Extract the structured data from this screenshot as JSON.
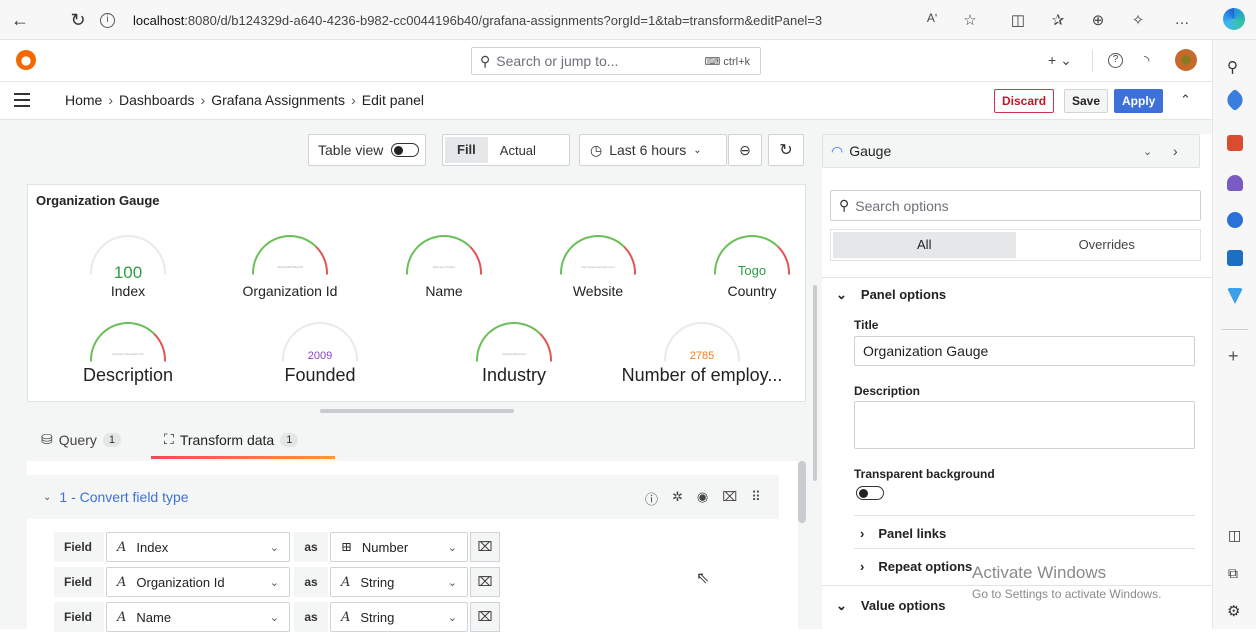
{
  "browser": {
    "url_host": "localhost",
    "url_rest": ":8080/d/b124329d-a640-4236-b982-cc0044196b40/grafana-assignments?orgId=1&tab=transform&editPanel=3",
    "read_aloud": "Aʹ",
    "more": "…"
  },
  "topbar": {
    "search_placeholder": "Search or jump to...",
    "search_shortcut": "ctrl+k",
    "plus": "+ ⌄"
  },
  "breadcrumb": {
    "items": [
      "Home",
      "Dashboards",
      "Grafana Assignments",
      "Edit panel"
    ],
    "separator": "›",
    "discard": "Discard",
    "save": "Save",
    "apply": "Apply"
  },
  "toolbar": {
    "table_view": "Table view",
    "fill": "Fill",
    "actual": "Actual",
    "time_range": "Last 6 hours"
  },
  "panel": {
    "title": "Organization Gauge",
    "gauges": [
      {
        "label": "Index",
        "value": "100",
        "value_color": "#2f9e44",
        "arc_color": "#e8eaed",
        "tiny": ""
      },
      {
        "label": "Organization Id",
        "value": "",
        "value_color": "#999",
        "arc_color": "#6bbf59",
        "tiny": "a1b2c3d4e5f6g7h8"
      },
      {
        "label": "Name",
        "value": "",
        "value_color": "#999",
        "arc_color": "#6bbf59",
        "tiny": "Robinson Parker"
      },
      {
        "label": "Website",
        "value": "",
        "value_color": "#999",
        "arc_color": "#6bbf59",
        "tiny": "http://www.example.com/"
      },
      {
        "label": "Country",
        "value": "Togo",
        "value_color": "#2f9e44",
        "arc_color": "#6bbf59",
        "tiny": ""
      },
      {
        "label": "Description",
        "value": "",
        "value_color": "#999",
        "arc_color": "#6bbf59",
        "tiny": "Focused bifurcated info"
      },
      {
        "label": "Founded",
        "value": "2009",
        "value_color": "#8a44c8",
        "arc_color": "#e8eaed",
        "tiny": ""
      },
      {
        "label": "Industry",
        "value": "",
        "value_color": "#999",
        "arc_color": "#6bbf59",
        "tiny": "Plastics Business"
      },
      {
        "label": "Number of employ...",
        "value": "2785",
        "value_color": "#f57c20",
        "arc_color": "#e8eaed",
        "tiny": ""
      }
    ]
  },
  "tabs": [
    {
      "label": "Query",
      "count": "1"
    },
    {
      "label": "Transform data",
      "count": "1"
    }
  ],
  "transform": {
    "title": "1 - Convert field type",
    "field_label": "Field",
    "as_label": "as",
    "rows": [
      {
        "field": "Index",
        "type": "Number",
        "type_icon": "number"
      },
      {
        "field": "Organization Id",
        "type": "String",
        "type_icon": "string"
      },
      {
        "field": "Name",
        "type": "String",
        "type_icon": "string"
      }
    ]
  },
  "options": {
    "viz_name": "Gauge",
    "search_placeholder": "Search options",
    "tab_all": "All",
    "tab_overrides": "Overrides",
    "panel_options": "Panel options",
    "title_label": "Title",
    "title_value": "Organization Gauge",
    "description_label": "Description",
    "transparent_label": "Transparent background",
    "panel_links": "Panel links",
    "repeat_options": "Repeat options",
    "value_options": "Value options"
  },
  "watermark": {
    "line1": "Activate Windows",
    "line2": "Go to Settings to activate Windows."
  }
}
